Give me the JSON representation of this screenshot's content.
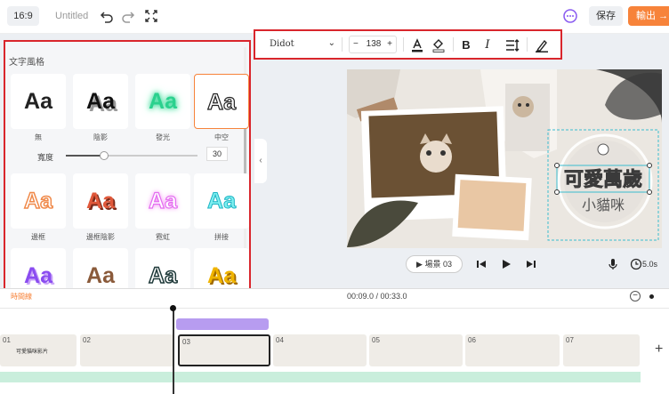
{
  "topbar": {
    "ratio": "16:9",
    "title": "Untitled",
    "save_label": "保存",
    "export_label": "輸出"
  },
  "format_toolbar": {
    "font": "Didot",
    "size_minus": "−",
    "font_size": "138",
    "size_plus": "+",
    "bold": "B",
    "italic": "I"
  },
  "style_panel": {
    "title": "文字風格",
    "sample": "Aa",
    "width_label": "寬度",
    "width_value": "30",
    "styles": [
      {
        "label": "無"
      },
      {
        "label": "陰影"
      },
      {
        "label": "發光"
      },
      {
        "label": "中空"
      },
      {
        "label": "邊框"
      },
      {
        "label": "邊框陰影"
      },
      {
        "label": "霓虹"
      },
      {
        "label": "拼接"
      },
      {
        "label": ""
      },
      {
        "label": ""
      },
      {
        "label": ""
      },
      {
        "label": ""
      }
    ]
  },
  "canvas": {
    "heading": "可愛萬歲",
    "subheading": "小貓咪"
  },
  "playback": {
    "scene_label": "▶ 場景 03",
    "duration": "5.0s"
  },
  "timeline": {
    "label": "時間線",
    "timecode": "00:09.0 / 00:33.0",
    "clips": [
      {
        "num": "01"
      },
      {
        "num": "02"
      },
      {
        "num": "03"
      },
      {
        "num": "04"
      },
      {
        "num": "05"
      },
      {
        "num": "06"
      },
      {
        "num": "07"
      }
    ],
    "clip1_caption": "可愛貓咪影片"
  },
  "colors": {
    "accent": "#f7833a",
    "highlight_border": "#d9262c",
    "text_track": "#b79cf0",
    "audio_track": "#c9eedc"
  }
}
